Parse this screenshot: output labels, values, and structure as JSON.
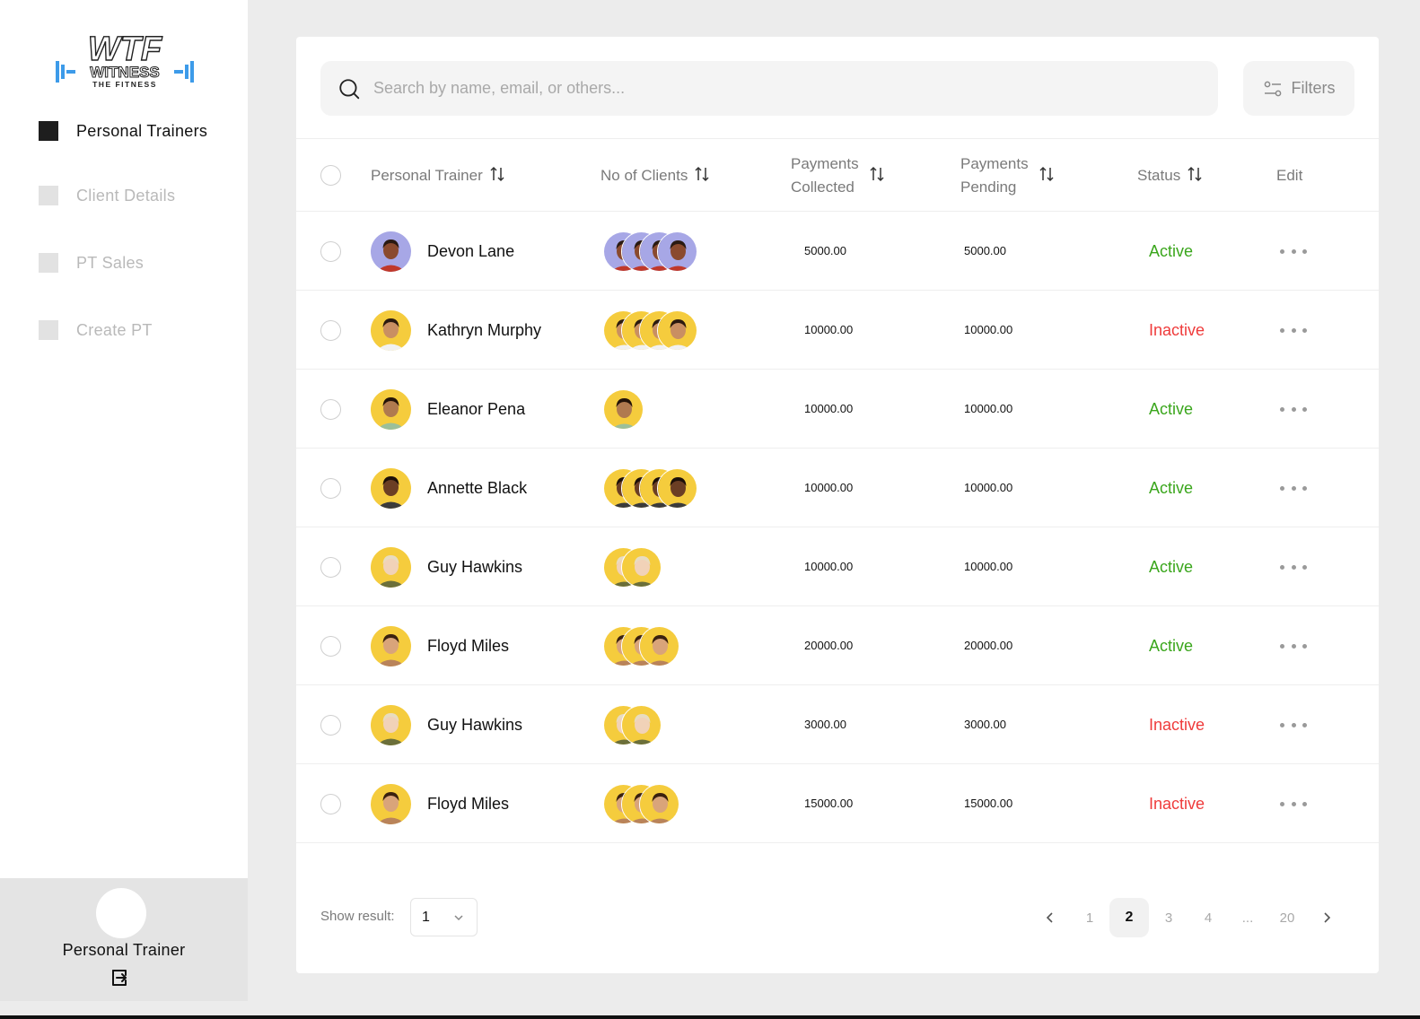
{
  "brand": {
    "logo_main": "WTF",
    "logo_sub": "WITNESS",
    "logo_tag": "THE FITNESS",
    "logo_color": "#3d9be9"
  },
  "sidebar": {
    "items": [
      {
        "label": "Personal Trainers",
        "active": true
      },
      {
        "label": "Client Details",
        "active": false
      },
      {
        "label": "PT Sales",
        "active": false
      },
      {
        "label": "Create PT",
        "active": false
      }
    ],
    "user_role": "Personal Trainer",
    "logout_icon": "logout-icon"
  },
  "search": {
    "placeholder": "Search by name, email, or others..."
  },
  "filters_label": "Filters",
  "table": {
    "headers": {
      "trainer": "Personal Trainer",
      "clients": "No of Clients",
      "collected_1": "Payments",
      "collected_2": "Collected",
      "pending_1": "Payments",
      "pending_2": "Pending",
      "status": "Status",
      "edit": "Edit"
    },
    "rows": [
      {
        "name": "Devon Lane",
        "clients": 4,
        "collected": "5000.00",
        "pending": "5000.00",
        "status": "Active",
        "avatar_bg": "#a7a7e6",
        "skin": "#8a4a2e",
        "hair": "#2a1a12",
        "shirt": "#c0392b"
      },
      {
        "name": "Kathryn Murphy",
        "clients": 4,
        "collected": "10000.00",
        "pending": "10000.00",
        "status": "Inactive",
        "avatar_bg": "#f5cc3d",
        "skin": "#c98f62",
        "hair": "#2b1a0f",
        "shirt": "#f1f1f1"
      },
      {
        "name": "Eleanor Pena",
        "clients": 1,
        "collected": "10000.00",
        "pending": "10000.00",
        "status": "Active",
        "avatar_bg": "#f5cc3d",
        "skin": "#b07a4f",
        "hair": "#231308",
        "shirt": "#9bbf9a"
      },
      {
        "name": "Annette Black",
        "clients": 4,
        "collected": "10000.00",
        "pending": "10000.00",
        "status": "Active",
        "avatar_bg": "#f5cc3d",
        "skin": "#6b3e24",
        "hair": "#1c0f08",
        "shirt": "#3b3b3b"
      },
      {
        "name": "Guy Hawkins",
        "clients": 2,
        "collected": "10000.00",
        "pending": "10000.00",
        "status": "Active",
        "avatar_bg": "#f5cc3d",
        "skin": "#f1d2b8",
        "hair": "#e8dcc0",
        "shirt": "#6b6f3a"
      },
      {
        "name": "Floyd Miles",
        "clients": 3,
        "collected": "20000.00",
        "pending": "20000.00",
        "status": "Active",
        "avatar_bg": "#f5cc3d",
        "skin": "#d9a47a",
        "hair": "#3a210f",
        "shirt": "#b9835a"
      },
      {
        "name": "Guy Hawkins",
        "clients": 2,
        "collected": "3000.00",
        "pending": "3000.00",
        "status": "Inactive",
        "avatar_bg": "#f5cc3d",
        "skin": "#f1d2b8",
        "hair": "#e8dcc0",
        "shirt": "#6b6f3a"
      },
      {
        "name": "Floyd Miles",
        "clients": 3,
        "collected": "15000.00",
        "pending": "15000.00",
        "status": "Inactive",
        "avatar_bg": "#f5cc3d",
        "skin": "#d9a47a",
        "hair": "#3a210f",
        "shirt": "#b9835a"
      }
    ]
  },
  "footer": {
    "show_result_label": "Show result:",
    "show_result_value": "1",
    "pages": [
      "1",
      "2",
      "3",
      "4",
      "...",
      "20"
    ],
    "current_page": "2"
  },
  "colors": {
    "active": "#3aa61c",
    "inactive": "#ef3b3b"
  }
}
